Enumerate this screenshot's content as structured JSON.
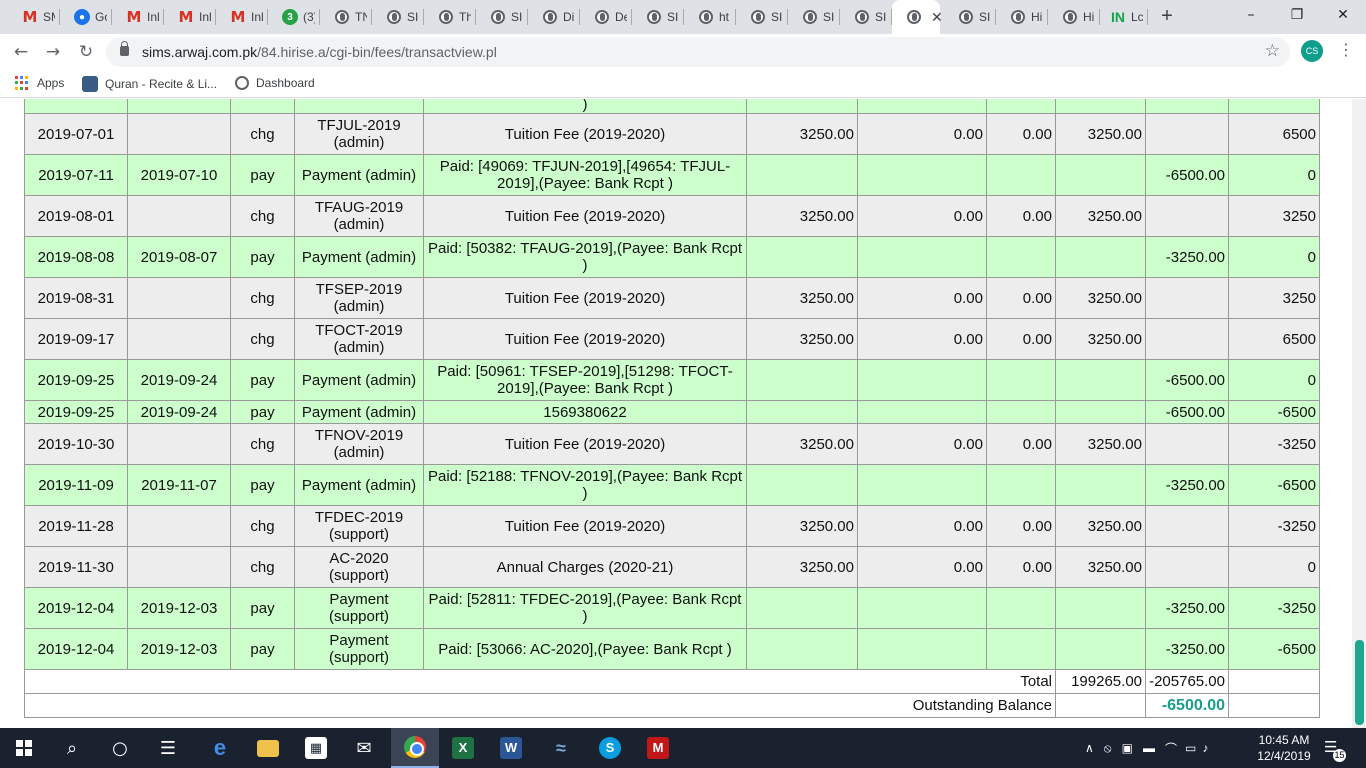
{
  "browser": {
    "tabs": [
      {
        "icon": "gmail-icon",
        "title": "SM"
      },
      {
        "icon": "google-account-icon",
        "title": "Go"
      },
      {
        "icon": "gmail-icon",
        "title": "Inl"
      },
      {
        "icon": "gmail-icon",
        "title": "Inl"
      },
      {
        "icon": "gmail-icon",
        "title": "Inl"
      },
      {
        "icon": "whatsapp-icon",
        "title": "(3)",
        "badge": "3"
      },
      {
        "icon": "globe-icon",
        "title": "TN"
      },
      {
        "icon": "globe-icon",
        "title": "SII"
      },
      {
        "icon": "globe-icon",
        "title": "Th"
      },
      {
        "icon": "globe-icon",
        "title": "SII"
      },
      {
        "icon": "globe-icon",
        "title": "Di"
      },
      {
        "icon": "globe-icon",
        "title": "De"
      },
      {
        "icon": "globe-icon",
        "title": "SII"
      },
      {
        "icon": "globe-icon",
        "title": "ht"
      },
      {
        "icon": "globe-icon",
        "title": "SII"
      },
      {
        "icon": "globe-icon",
        "title": "SII"
      },
      {
        "icon": "globe-icon",
        "title": "SII"
      },
      {
        "icon": "globe-icon",
        "title": "",
        "active": true
      },
      {
        "icon": "globe-icon",
        "title": "SII"
      },
      {
        "icon": "globe-icon",
        "title": "Hi"
      },
      {
        "icon": "globe-icon",
        "title": "Hi"
      },
      {
        "icon": "in-icon",
        "title": "Lc"
      }
    ],
    "new_tab": "+",
    "url_host": "sims.arwaj.com.pk",
    "url_path": "/84.hirise.a/cgi-bin/fees/transactview.pl",
    "profile_initials": "CS",
    "bookmarks": [
      {
        "icon": "apps-grid-icon",
        "label": "Apps"
      },
      {
        "icon": "quran-icon",
        "label": "Quran - Recite & Li..."
      },
      {
        "icon": "dashboard-icon",
        "label": "Dashboard"
      }
    ]
  },
  "ledger": {
    "top_partial": ")",
    "rows": [
      {
        "kind": "chg",
        "date": "2019-07-01",
        "date2": "",
        "type": "chg",
        "ref": "TFJUL-2019 (admin)",
        "desc": "Tuition Fee (2019-2020)",
        "amount": "3250.00",
        "disc": "0.00",
        "fine": "0.00",
        "net": "3250.00",
        "paid": "",
        "balance": "6500"
      },
      {
        "kind": "pay",
        "date": "2019-07-11",
        "date2": "2019-07-10",
        "type": "pay",
        "ref": "Payment (admin)",
        "desc": "Paid: [49069: TFJUN-2019],[49654: TFJUL-2019],(Payee: Bank Rcpt )",
        "amount": "",
        "disc": "",
        "fine": "",
        "net": "",
        "paid": "-6500.00",
        "balance": "0"
      },
      {
        "kind": "chg",
        "date": "2019-08-01",
        "date2": "",
        "type": "chg",
        "ref": "TFAUG-2019 (admin)",
        "desc": "Tuition Fee (2019-2020)",
        "amount": "3250.00",
        "disc": "0.00",
        "fine": "0.00",
        "net": "3250.00",
        "paid": "",
        "balance": "3250"
      },
      {
        "kind": "pay",
        "date": "2019-08-08",
        "date2": "2019-08-07",
        "type": "pay",
        "ref": "Payment (admin)",
        "desc": "Paid: [50382: TFAUG-2019],(Payee: Bank Rcpt )",
        "amount": "",
        "disc": "",
        "fine": "",
        "net": "",
        "paid": "-3250.00",
        "balance": "0"
      },
      {
        "kind": "chg",
        "date": "2019-08-31",
        "date2": "",
        "type": "chg",
        "ref": "TFSEP-2019 (admin)",
        "desc": "Tuition Fee (2019-2020)",
        "amount": "3250.00",
        "disc": "0.00",
        "fine": "0.00",
        "net": "3250.00",
        "paid": "",
        "balance": "3250"
      },
      {
        "kind": "chg",
        "date": "2019-09-17",
        "date2": "",
        "type": "chg",
        "ref": "TFOCT-2019 (admin)",
        "desc": "Tuition Fee (2019-2020)",
        "amount": "3250.00",
        "disc": "0.00",
        "fine": "0.00",
        "net": "3250.00",
        "paid": "",
        "balance": "6500"
      },
      {
        "kind": "pay",
        "date": "2019-09-25",
        "date2": "2019-09-24",
        "type": "pay",
        "ref": "Payment (admin)",
        "desc": "Paid: [50961: TFSEP-2019],[51298: TFOCT-2019],(Payee: Bank Rcpt )",
        "amount": "",
        "disc": "",
        "fine": "",
        "net": "",
        "paid": "-6500.00",
        "balance": "0"
      },
      {
        "kind": "pay",
        "short": true,
        "date": "2019-09-25",
        "date2": "2019-09-24",
        "type": "pay",
        "ref": "Payment (admin)",
        "desc": "1569380622",
        "amount": "",
        "disc": "",
        "fine": "",
        "net": "",
        "paid": "-6500.00",
        "balance": "-6500"
      },
      {
        "kind": "chg",
        "date": "2019-10-30",
        "date2": "",
        "type": "chg",
        "ref": "TFNOV-2019 (admin)",
        "desc": "Tuition Fee (2019-2020)",
        "amount": "3250.00",
        "disc": "0.00",
        "fine": "0.00",
        "net": "3250.00",
        "paid": "",
        "balance": "-3250"
      },
      {
        "kind": "pay",
        "date": "2019-11-09",
        "date2": "2019-11-07",
        "type": "pay",
        "ref": "Payment (admin)",
        "desc": "Paid: [52188: TFNOV-2019],(Payee: Bank Rcpt )",
        "amount": "",
        "disc": "",
        "fine": "",
        "net": "",
        "paid": "-3250.00",
        "balance": "-6500"
      },
      {
        "kind": "chg",
        "date": "2019-11-28",
        "date2": "",
        "type": "chg",
        "ref": "TFDEC-2019 (support)",
        "desc": "Tuition Fee (2019-2020)",
        "amount": "3250.00",
        "disc": "0.00",
        "fine": "0.00",
        "net": "3250.00",
        "paid": "",
        "balance": "-3250"
      },
      {
        "kind": "chg",
        "date": "2019-11-30",
        "date2": "",
        "type": "chg",
        "ref": "AC-2020 (support)",
        "desc": "Annual Charges (2020-21)",
        "amount": "3250.00",
        "disc": "0.00",
        "fine": "0.00",
        "net": "3250.00",
        "paid": "",
        "balance": "0"
      },
      {
        "kind": "pay",
        "date": "2019-12-04",
        "date2": "2019-12-03",
        "type": "pay",
        "ref": "Payment (support)",
        "desc": "Paid: [52811: TFDEC-2019],(Payee: Bank Rcpt )",
        "amount": "",
        "disc": "",
        "fine": "",
        "net": "",
        "paid": "-3250.00",
        "balance": "-3250"
      },
      {
        "kind": "pay",
        "date": "2019-12-04",
        "date2": "2019-12-03",
        "type": "pay",
        "ref": "Payment (support)",
        "desc": "Paid: [53066: AC-2020],(Payee: Bank Rcpt )",
        "amount": "",
        "disc": "",
        "fine": "",
        "net": "",
        "paid": "-3250.00",
        "balance": "-6500"
      }
    ],
    "total_label": "Total",
    "total_charged": "199265.00",
    "total_paid": "-205765.00",
    "outstanding_label": "Outstanding Balance",
    "outstanding_value": "-6500.00"
  },
  "colors": {
    "charge_row": "#ededed",
    "payment_row": "#ccffcc",
    "outstanding": "#1a9e8c",
    "scroll_thumb": "#1ca88e"
  },
  "taskbar": {
    "items": [
      "windows-start-icon",
      "search-icon",
      "cortana-icon",
      "task-view-icon",
      "edge-icon",
      "file-explorer-icon",
      "store-icon",
      "mail-icon",
      "chrome-icon",
      "excel-icon",
      "word-icon",
      "dolphin-icon",
      "skype-icon",
      "mcafee-icon"
    ],
    "time": "10:45 AM",
    "date": "12/4/2019",
    "notifications": "15"
  }
}
